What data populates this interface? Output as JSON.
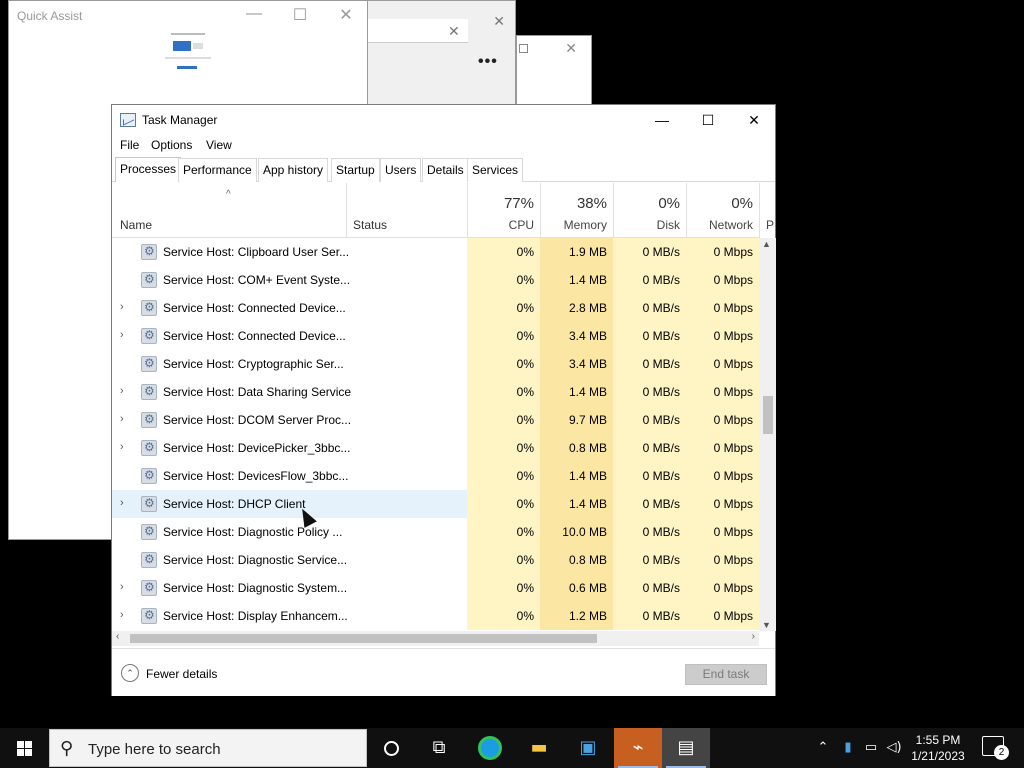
{
  "quick_assist": {
    "title": "Quick Assist"
  },
  "task_manager": {
    "title": "Task Manager",
    "menu": [
      "File",
      "Options",
      "View"
    ],
    "tabs": [
      "Processes",
      "Performance",
      "App history",
      "Startup",
      "Users",
      "Details",
      "Services"
    ],
    "active_tab": "Processes",
    "columns": {
      "name": "Name",
      "status": "Status",
      "cpu": {
        "pct": "77%",
        "label": "CPU"
      },
      "memory": {
        "pct": "38%",
        "label": "Memory"
      },
      "disk": {
        "pct": "0%",
        "label": "Disk"
      },
      "network": {
        "pct": "0%",
        "label": "Network"
      },
      "power": "P"
    },
    "processes": [
      {
        "name": "Service Host: Clipboard User Ser...",
        "expandable": false,
        "cpu": "0%",
        "memory": "1.9 MB",
        "disk": "0 MB/s",
        "network": "0 Mbps"
      },
      {
        "name": "Service Host: COM+ Event Syste...",
        "expandable": false,
        "cpu": "0%",
        "memory": "1.4 MB",
        "disk": "0 MB/s",
        "network": "0 Mbps"
      },
      {
        "name": "Service Host: Connected Device...",
        "expandable": true,
        "cpu": "0%",
        "memory": "2.8 MB",
        "disk": "0 MB/s",
        "network": "0 Mbps"
      },
      {
        "name": "Service Host: Connected Device...",
        "expandable": true,
        "cpu": "0%",
        "memory": "3.4 MB",
        "disk": "0 MB/s",
        "network": "0 Mbps"
      },
      {
        "name": "Service Host: Cryptographic Ser...",
        "expandable": false,
        "cpu": "0%",
        "memory": "3.4 MB",
        "disk": "0 MB/s",
        "network": "0 Mbps"
      },
      {
        "name": "Service Host: Data Sharing Service",
        "expandable": true,
        "cpu": "0%",
        "memory": "1.4 MB",
        "disk": "0 MB/s",
        "network": "0 Mbps"
      },
      {
        "name": "Service Host: DCOM Server Proc...",
        "expandable": true,
        "cpu": "0%",
        "memory": "9.7 MB",
        "disk": "0 MB/s",
        "network": "0 Mbps"
      },
      {
        "name": "Service Host: DevicePicker_3bbc...",
        "expandable": true,
        "cpu": "0%",
        "memory": "0.8 MB",
        "disk": "0 MB/s",
        "network": "0 Mbps"
      },
      {
        "name": "Service Host: DevicesFlow_3bbc...",
        "expandable": false,
        "cpu": "0%",
        "memory": "1.4 MB",
        "disk": "0 MB/s",
        "network": "0 Mbps"
      },
      {
        "name": "Service Host: DHCP Client",
        "expandable": true,
        "hover": true,
        "cpu": "0%",
        "memory": "1.4 MB",
        "disk": "0 MB/s",
        "network": "0 Mbps"
      },
      {
        "name": "Service Host: Diagnostic Policy ...",
        "expandable": false,
        "cpu": "0%",
        "memory": "10.0 MB",
        "disk": "0 MB/s",
        "network": "0 Mbps"
      },
      {
        "name": "Service Host: Diagnostic Service...",
        "expandable": false,
        "cpu": "0%",
        "memory": "0.8 MB",
        "disk": "0 MB/s",
        "network": "0 Mbps"
      },
      {
        "name": "Service Host: Diagnostic System...",
        "expandable": true,
        "cpu": "0%",
        "memory": "0.6 MB",
        "disk": "0 MB/s",
        "network": "0 Mbps"
      },
      {
        "name": "Service Host: Display Enhancem...",
        "expandable": true,
        "cpu": "0%",
        "memory": "1.2 MB",
        "disk": "0 MB/s",
        "network": "0 Mbps"
      }
    ],
    "footer": {
      "fewer_details": "Fewer details",
      "end_task": "End task"
    }
  },
  "taskbar": {
    "search_placeholder": "Type here to search",
    "time": "1:55 PM",
    "date": "1/21/2023",
    "notification_count": "2"
  }
}
